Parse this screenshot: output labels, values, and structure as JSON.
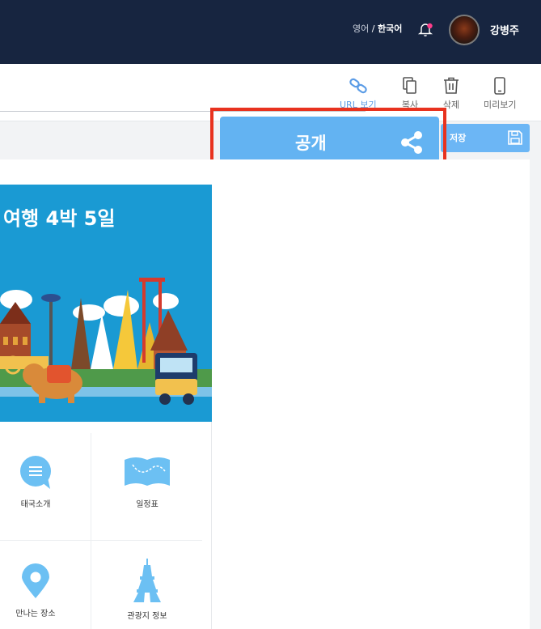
{
  "header": {
    "lang_option": "영어",
    "lang_separator": " / ",
    "lang_current": "한국어",
    "user_name": "강병주"
  },
  "toolbar": {
    "url_view": "URL 보기",
    "copy": "복사",
    "delete": "삭제",
    "preview": "미리보기"
  },
  "actions": {
    "save": "저장",
    "publish": "공개"
  },
  "banner": {
    "title": "여행 4박 5일"
  },
  "menu": [
    {
      "label": "태국소개",
      "icon": "chat-bubble-icon"
    },
    {
      "label": "일정표",
      "icon": "map-icon"
    },
    {
      "label": "만나는 장소",
      "icon": "location-pin-icon"
    },
    {
      "label": "관광지 정보",
      "icon": "eiffel-tower-icon"
    }
  ],
  "colors": {
    "navbar": "#172540",
    "accent": "#63b3f2",
    "highlight": "#e8321f",
    "banner": "#1a9ad3"
  }
}
